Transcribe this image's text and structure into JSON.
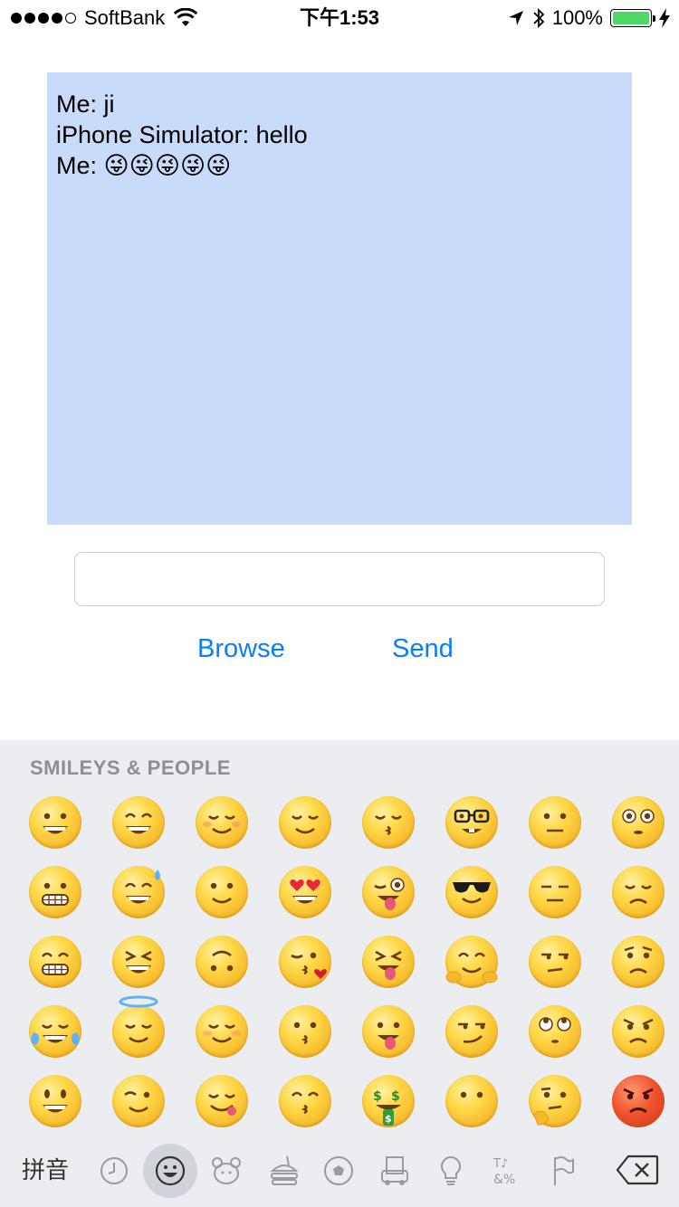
{
  "status_bar": {
    "carrier": "SoftBank",
    "time": "下午1:53",
    "battery_percent": "100%",
    "battery_level": 1.0,
    "battery_color": "#4cd964"
  },
  "chat": {
    "lines": [
      {
        "sender": "Me:",
        "text": "ji"
      },
      {
        "sender": "iPhone Simulator:",
        "text": "hello"
      },
      {
        "sender": "Me:",
        "text": "😜😜😜😜😜"
      }
    ],
    "background_color": "#c9dbfb"
  },
  "input": {
    "value": "",
    "placeholder": ""
  },
  "buttons": {
    "browse": "Browse",
    "send": "Send",
    "accent_color": "#0a7cff"
  },
  "keyboard": {
    "section_title": "SMILEYS & PEOPLE",
    "input_mode": "拼音",
    "emoji_rows": [
      [
        "grinning",
        "smile",
        "blush",
        "relieved",
        "kissing-closed-eyes",
        "nerd",
        "neutral",
        "flushed"
      ],
      [
        "grimacing",
        "sweat-smile",
        "slight-smile",
        "heart-eyes",
        "winking-tongue",
        "sunglasses",
        "expressionless",
        "disappointed"
      ],
      [
        "grin",
        "laughing",
        "upside-down",
        "kissing-heart",
        "squinting-tongue",
        "hugging",
        "unamused",
        "worried"
      ],
      [
        "joy",
        "innocent",
        "smiling-relaxed",
        "kissing",
        "tongue-out",
        "smirk",
        "eye-roll",
        "angry"
      ],
      [
        "smiley",
        "wink",
        "yum",
        "kissing-smiling-eyes",
        "money-mouth",
        "no-mouth",
        "thinking",
        "rage"
      ]
    ],
    "categories": [
      {
        "name": "recent-icon"
      },
      {
        "name": "smileys-icon",
        "active": true
      },
      {
        "name": "animals-icon"
      },
      {
        "name": "food-icon"
      },
      {
        "name": "activity-icon"
      },
      {
        "name": "travel-icon"
      },
      {
        "name": "objects-icon"
      },
      {
        "name": "symbols-icon"
      },
      {
        "name": "flags-icon"
      }
    ],
    "delete_icon": "delete-icon"
  }
}
